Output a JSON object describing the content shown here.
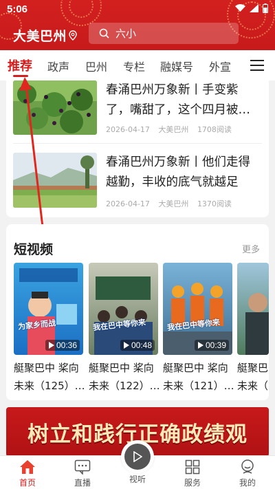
{
  "status_bar": {
    "time": "5:06"
  },
  "header": {
    "brand": "大美巴州",
    "search_placeholder": "六小"
  },
  "nav": {
    "tabs": [
      "推荐",
      "政声",
      "巴州",
      "专栏",
      "融媒号",
      "外宣"
    ],
    "active_index": 0
  },
  "articles": [
    {
      "title_line1": "春涌巴州万象新丨手变紫",
      "title_line2": "了，嘴甜了，这个四月被…",
      "date": "2026-04-17",
      "source": "大美巴州",
      "reads": "1708阅读"
    },
    {
      "title_line1": "春涌巴州万象新丨他们走得",
      "title_line2": "越勤，丰收的底气就越足",
      "date": "2026-04-17",
      "source": "大美巴州",
      "reads": "1370阅读"
    }
  ],
  "short_video": {
    "title": "短视频",
    "more": "更多",
    "items": [
      {
        "duration": "00:36",
        "title_line1": "艇聚巴中 桨向",
        "title_line2": "未来（125）…",
        "caption": "为家乡而战"
      },
      {
        "duration": "00:48",
        "title_line1": "艇聚巴中 桨向",
        "title_line2": "未来（122）…",
        "caption": "我在巴中等你来"
      },
      {
        "duration": "00:39",
        "title_line1": "艇聚巴中 桨向",
        "title_line2": "未来（121）…",
        "caption": "我在巴中等你来"
      },
      {
        "duration": "",
        "title_line1": "艇聚巴中",
        "title_line2": "未来（",
        "caption": ""
      }
    ]
  },
  "banner": {
    "text": "树立和践行正确政绩观"
  },
  "bottom_nav": {
    "items": [
      "首页",
      "直播",
      "视听",
      "服务",
      "我的"
    ],
    "active_index": 0
  },
  "colors": {
    "brand_red": "#d41e1e",
    "header_red": "#cf1f1f"
  }
}
